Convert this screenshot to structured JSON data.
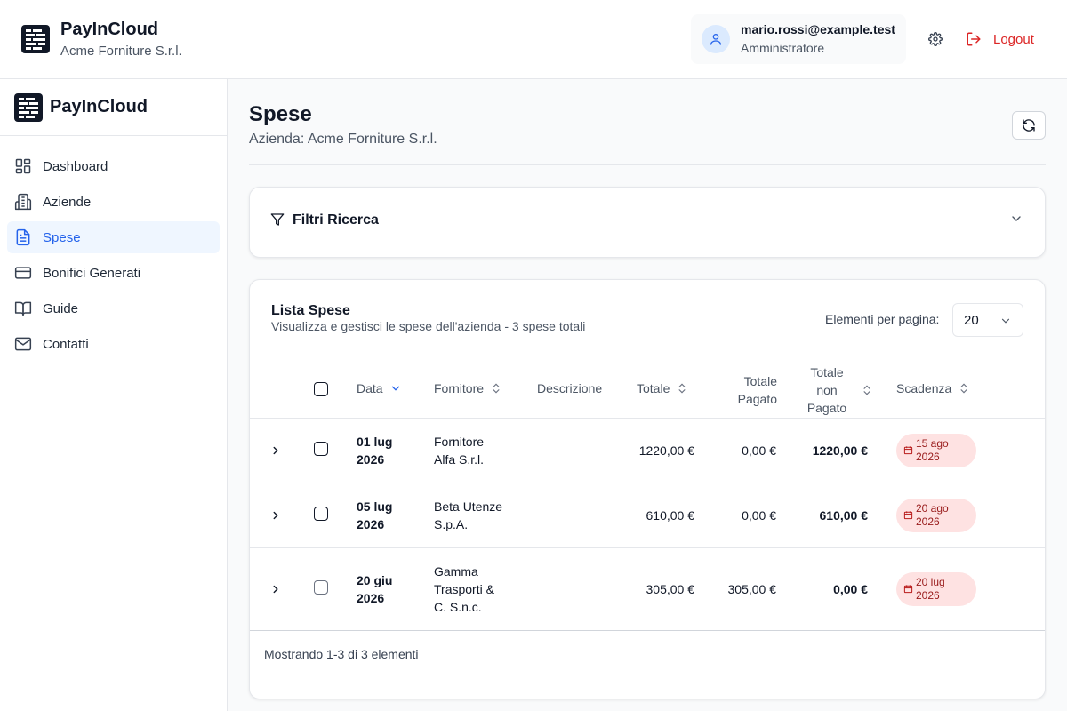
{
  "header": {
    "app_name": "PayInCloud",
    "company": "Acme Forniture S.r.l.",
    "user_email": "mario.rossi@example.test",
    "user_role": "Amministratore",
    "logout_label": "Logout"
  },
  "sidebar": {
    "title": "PayInCloud",
    "items": [
      {
        "label": "Dashboard",
        "icon": "dashboard-icon",
        "active": false
      },
      {
        "label": "Aziende",
        "icon": "building-icon",
        "active": false
      },
      {
        "label": "Spese",
        "icon": "document-icon",
        "active": true
      },
      {
        "label": "Bonifici Generati",
        "icon": "card-icon",
        "active": false
      },
      {
        "label": "Guide",
        "icon": "book-icon",
        "active": false
      },
      {
        "label": "Contatti",
        "icon": "mail-icon",
        "active": false
      }
    ]
  },
  "page": {
    "title": "Spese",
    "subtitle": "Azienda: Acme Forniture S.r.l."
  },
  "filters": {
    "title": "Filtri Ricerca"
  },
  "list": {
    "title": "Lista Spese",
    "subtitle": "Visualizza e gestisci le spese dell'azienda - 3 spese totali",
    "per_page_label": "Elementi per pagina:",
    "per_page_value": "20",
    "columns": {
      "data": "Data",
      "fornitore": "Fornitore",
      "descrizione": "Descrizione",
      "totale": "Totale",
      "totale_pagato_1": "Totale",
      "totale_pagato_2": "Pagato",
      "totale_non_pagato_1": "Totale",
      "totale_non_pagato_2": "non",
      "totale_non_pagato_3": "Pagato",
      "scadenza": "Scadenza"
    },
    "rows": [
      {
        "data_1": "01 lug",
        "data_2": "2026",
        "fornitore_1": "Fornitore",
        "fornitore_2": "Alfa S.r.l.",
        "fornitore_3": "",
        "totale": "1220,00 €",
        "pagato": "0,00 €",
        "non_pagato": "1220,00 €",
        "scadenza_1": "15 ago",
        "scadenza_2": "2026"
      },
      {
        "data_1": "05 lug",
        "data_2": "2026",
        "fornitore_1": "Beta Utenze",
        "fornitore_2": "S.p.A.",
        "fornitore_3": "",
        "totale": "610,00 €",
        "pagato": "0,00 €",
        "non_pagato": "610,00 €",
        "scadenza_1": "20 ago",
        "scadenza_2": "2026"
      },
      {
        "data_1": "20 giu",
        "data_2": "2026",
        "fornitore_1": "Gamma",
        "fornitore_2": "Trasporti &",
        "fornitore_3": "C. S.n.c.",
        "totale": "305,00 €",
        "pagato": "305,00 €",
        "non_pagato": "0,00 €",
        "scadenza_1": "20 lug",
        "scadenza_2": "2026"
      }
    ],
    "footer": "Mostrando 1-3 di 3 elementi"
  },
  "colors": {
    "accent": "#2563eb",
    "danger": "#dc2626",
    "badge_bg": "#fee2e2",
    "badge_text": "#991b1b"
  }
}
